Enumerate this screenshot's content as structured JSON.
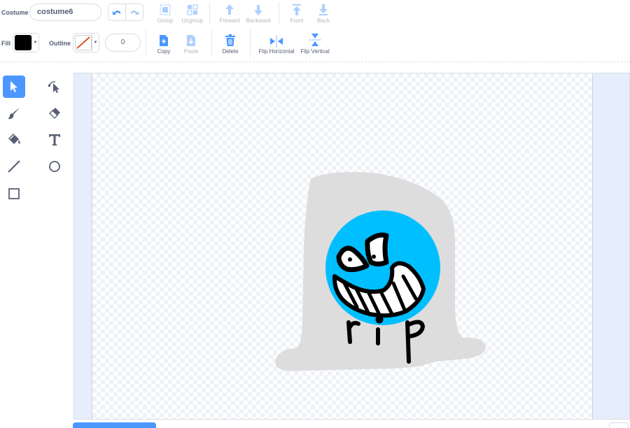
{
  "toolbar": {
    "costume_label": "Costume",
    "costume_name": "costume6",
    "buttons": {
      "group": "Group",
      "ungroup": "Ungroup",
      "forward": "Forward",
      "backward": "Backward",
      "front": "Front",
      "back": "Back",
      "copy": "Copy",
      "paste": "Paste",
      "delete": "Delete",
      "flip_horizontal": "Flip Horizontal",
      "flip_vertical": "Flip Vertical"
    },
    "fill_label": "Fill",
    "outline_label": "Outline",
    "outline_width": "0",
    "fill_color": "#000000"
  },
  "tools": {
    "active": "select",
    "items": [
      "select-icon",
      "reshape-icon",
      "brush-icon",
      "eraser-icon",
      "fill-icon",
      "text-icon",
      "line-icon",
      "circle-icon",
      "rectangle-icon"
    ]
  },
  "drawing": {
    "text": "rip",
    "tombstone_color": "#dddddd",
    "face_color": "#00bfff"
  },
  "colors": {
    "accent": "#4c97ff",
    "text": "#575e75",
    "disabled": "#b3cef5"
  }
}
